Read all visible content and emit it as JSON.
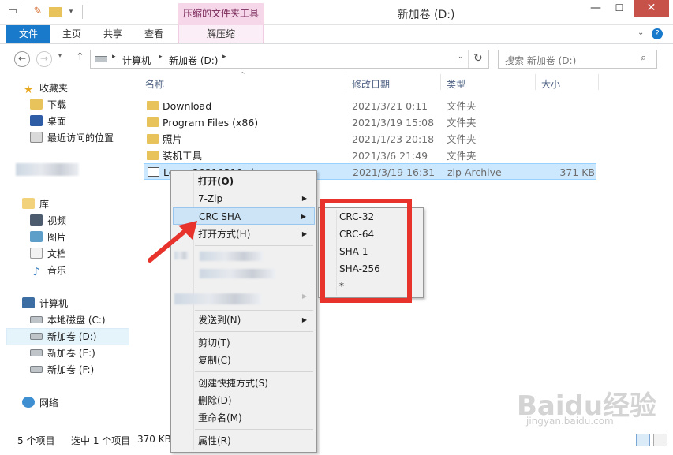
{
  "titlebar": {
    "context_tab_title": "压缩的文件夹工具",
    "window_title": "新加卷 (D:)",
    "minimize": "—",
    "maximize": "☐",
    "close": "✕"
  },
  "ribbon": {
    "tabs": [
      "文件",
      "主页",
      "共享",
      "查看",
      "解压缩"
    ]
  },
  "address": {
    "path": [
      "计算机",
      "新加卷 (D:)"
    ],
    "search_placeholder": "搜索 新加卷 (D:)"
  },
  "nav": {
    "favorites": "收藏夹",
    "downloads": "下载",
    "desktop": "桌面",
    "recent": "最近访问的位置",
    "libraries": "库",
    "videos": "视频",
    "pictures": "图片",
    "documents": "文档",
    "music": "音乐",
    "computer": "计算机",
    "drive_c": "本地磁盘 (C:)",
    "drive_d": "新加卷 (D:)",
    "drive_e": "新加卷 (E:)",
    "drive_f": "新加卷 (F:)",
    "network": "网络"
  },
  "columns": {
    "name": "名称",
    "date": "修改日期",
    "type": "类型",
    "size": "大小"
  },
  "files": [
    {
      "name": "Download",
      "date": "2021/3/21 0:11",
      "type": "文件夹",
      "size": ""
    },
    {
      "name": "Program Files (x86)",
      "date": "2021/3/19 15:08",
      "type": "文件夹",
      "size": ""
    },
    {
      "name": "照片",
      "date": "2021/1/23 20:18",
      "type": "文件夹",
      "size": ""
    },
    {
      "name": "装机工具",
      "date": "2021/3/6 21:49",
      "type": "文件夹",
      "size": ""
    },
    {
      "name": "Loc ...20210319.zip",
      "date": "2021/3/19 16:31",
      "type": "zip Archive",
      "size": "371 KB"
    }
  ],
  "context_menu": {
    "open": "打开(O)",
    "sevenzip": "7-Zip",
    "crc_sha": "CRC SHA",
    "open_with": "打开方式(H)",
    "send_to": "发送到(N)",
    "cut": "剪切(T)",
    "copy": "复制(C)",
    "create_shortcut": "创建快捷方式(S)",
    "delete": "删除(D)",
    "rename": "重命名(M)",
    "properties": "属性(R)"
  },
  "submenu": [
    "CRC-32",
    "CRC-64",
    "SHA-1",
    "SHA-256",
    "*"
  ],
  "status": {
    "item_count": "5 个项目",
    "selected": "选中 1 个项目",
    "size": "370 KB"
  },
  "watermark": {
    "brand": "Baidu经验",
    "url": "jingyan.baidu.com"
  },
  "colors": {
    "accent": "#1979ca",
    "highlight": "#cde4f7",
    "annotation": "#e8332d"
  }
}
